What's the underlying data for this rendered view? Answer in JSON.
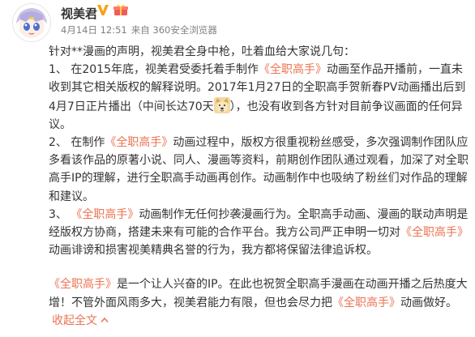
{
  "colors": {
    "accent": "#eb7350",
    "meta": "#808080",
    "text": "#333333"
  },
  "user": {
    "name": "视美君",
    "avatar_icon": "anime-face-avatar-icon",
    "badges": [
      "verified-v-icon",
      "gift-box-icon"
    ]
  },
  "meta": {
    "date": "4月14日 12:51",
    "source": "来自 360安全浏览器"
  },
  "post": {
    "p1": "针对**漫画的声明，视美君全身中枪，吐着血给大家说几句：",
    "p2a": "1、 在2015年底，视美君受委托着手制作",
    "p2b": "《全职高手》",
    "p2c": "动画至作品开播前，一直未收到其它相关版权的解释说明。2017年1月27日的全职高手贺新春PV动画播出后到4月7日正片播出（中间长达70天",
    "p2d": "），也没有收到各方针对目前争议画面的任何异议。",
    "p3a": "2、 在制作",
    "p3b": "《全职高手》",
    "p3c": "动画过程中，版权方很重视粉丝感受，多次强调制作团队应多看该作品的原著小说、同人、漫画等资料，前期创作团队通过观看，加深了对全职高手IP的理解，进行全职高手动画再创作。动画制作中也吸纳了粉丝们对作品的理解和建议。",
    "p4a": "3、 ",
    "p4b": "《全职高手》",
    "p4c": "动画制作无任何抄袭漫画行为。全职高手动画、漫画的联动声明是经版权方协商，搭建未来有可能的合作平台。我方公司严正申明一切对",
    "p4d": "《全职高手》",
    "p4e": "动画诽谤和损害视美精典名誉的行为，我方都将保留法律追诉权。",
    "p5a": "《全职高手》",
    "p5b": "是一个让人兴奋的IP。在此也祝贺全职高手漫画在动画开播之后热度大增！不管外面风雨多大，视美君能力有限，但也会尽力把",
    "p5c": "《全职高手》",
    "p5d": "动画做好。",
    "collapse": "收起全文",
    "emoji_icon": "doge-emoji-icon"
  }
}
